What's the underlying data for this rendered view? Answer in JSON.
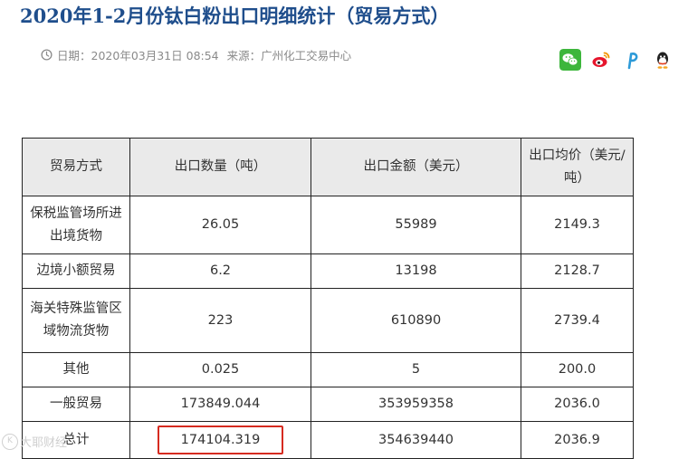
{
  "article": {
    "title": "2020年1-2月份钛白粉出口明细统计（贸易方式）",
    "meta": {
      "date_label": "日期：",
      "date_value": "2020年03月31日 08:54",
      "source_label": "来源：",
      "source_value": "广州化工交易中心"
    }
  },
  "share": {
    "icons": [
      "wechat-icon",
      "weibo-icon",
      "pinterest-icon",
      "qq-icon"
    ],
    "colors": {
      "wechat": "#3db63c",
      "weibo": "#e6162d",
      "pinterest": "#2d9ad8",
      "qq": "#2a2a2a"
    }
  },
  "table": {
    "headers": [
      "贸易方式",
      "出口数量（吨）",
      "出口金额（美元）",
      "出口均价（美元/吨）"
    ],
    "rows": [
      [
        "保税监管场所进出境货物",
        "26.05",
        "55989",
        "2149.3"
      ],
      [
        "边境小额贸易",
        "6.2",
        "13198",
        "2128.7"
      ],
      [
        "海关特殊监管区域物流货物",
        "223",
        "610890",
        "2739.4"
      ],
      [
        "其他",
        "0.025",
        "5",
        "200.0"
      ],
      [
        "一般贸易",
        "173849.044",
        "353959358",
        "2036.0"
      ],
      [
        "总计",
        "174104.319",
        "354639440",
        "2036.9"
      ]
    ],
    "highlight_color": "#d62b20",
    "header_bg": "#eaeaea"
  },
  "watermark": {
    "logo": "K",
    "text": "大耶财经"
  }
}
